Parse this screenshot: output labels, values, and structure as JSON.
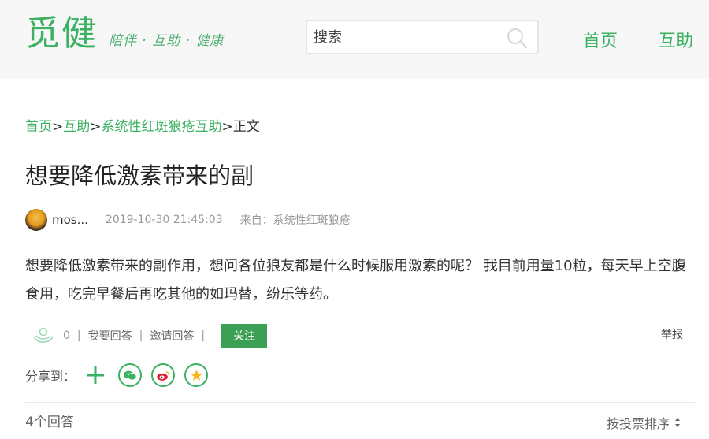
{
  "header": {
    "logo_text": "觅健",
    "slogan": "陪伴 · 互助 · 健康",
    "search": {
      "placeholder": "搜索"
    },
    "nav": {
      "home": "首页",
      "help": "互助"
    }
  },
  "breadcrumb": {
    "items": [
      "首页",
      "互助",
      "系统性红斑狼疮互助",
      "正文"
    ],
    "separator": ">"
  },
  "post": {
    "title": "想要降低激素带来的副",
    "author": "mos...",
    "date": "2019-10-30 21:45:03",
    "source": "来自：系统性红斑狼疮",
    "content": "想要降低激素带来的副作用，想问各位狼友都是什么时候服用激素的呢？ 我目前用量10粒，每天早上空腹食用，吃完早餐后再吃其他的如玛替，纷乐等药。"
  },
  "actions": {
    "count": "0",
    "answer_label": "我要回答",
    "invite_label": "邀请回答",
    "divider": "|",
    "follow_label": "关注",
    "report_label": "举报"
  },
  "share": {
    "label": "分享到："
  },
  "answers": {
    "count_label": "4个回答",
    "sort_label": "按投票排序"
  },
  "colors": {
    "brand_green": "#3bb162",
    "follow_button": "#3ba054",
    "weibo_red": "#e6162d",
    "qzone_yellow": "#f5b920"
  }
}
